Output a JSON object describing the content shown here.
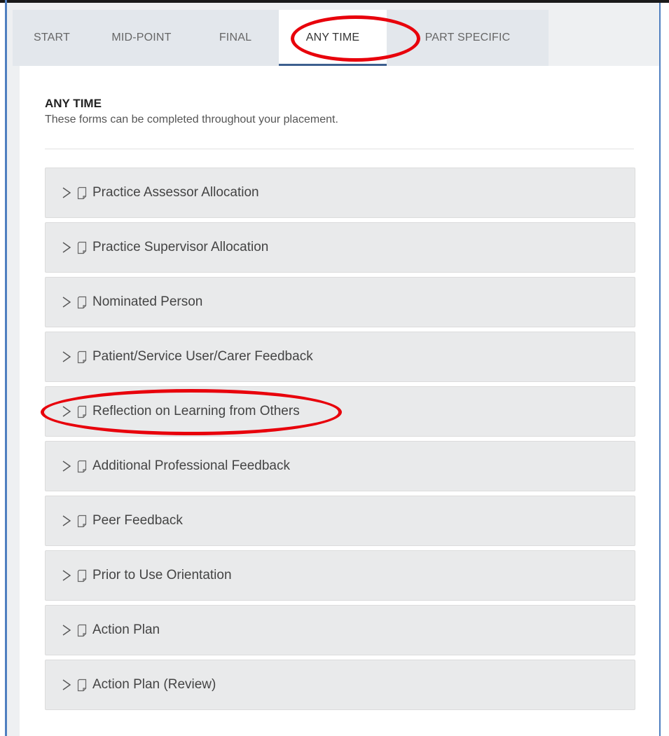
{
  "tabs": [
    {
      "label": "START",
      "active": false
    },
    {
      "label": "MID-POINT",
      "active": false
    },
    {
      "label": "FINAL",
      "active": false
    },
    {
      "label": "ANY TIME",
      "active": true
    },
    {
      "label": "PART SPECIFIC",
      "active": false
    }
  ],
  "section": {
    "title": "ANY TIME",
    "description": "These forms can be completed throughout your placement."
  },
  "forms": [
    {
      "label": "Practice Assessor Allocation"
    },
    {
      "label": "Practice Supervisor Allocation"
    },
    {
      "label": "Nominated Person"
    },
    {
      "label": "Patient/Service User/Carer Feedback"
    },
    {
      "label": "Reflection on Learning from Others"
    },
    {
      "label": "Additional Professional Feedback"
    },
    {
      "label": "Peer Feedback"
    },
    {
      "label": "Prior to Use Orientation"
    },
    {
      "label": "Action Plan"
    },
    {
      "label": "Action Plan (Review)"
    }
  ],
  "icons": {
    "expand": "chevron-right-icon",
    "form": "document-icon"
  },
  "colors": {
    "active_tab_underline": "#3d5f8f",
    "annotation": "#e8000b",
    "item_background": "#e9eaeb"
  }
}
